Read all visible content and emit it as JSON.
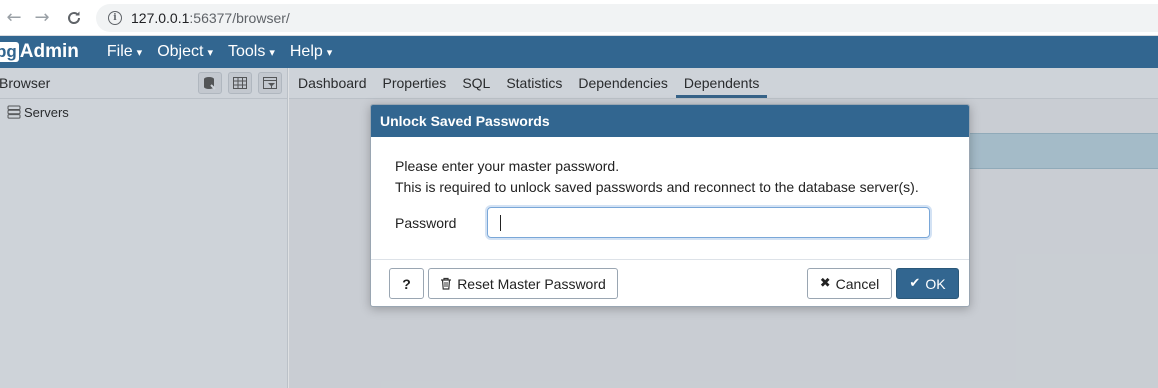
{
  "browser": {
    "url_host": "127.0.0.1",
    "url_rest": ":56377/browser/"
  },
  "navbar": {
    "logo_pg": "pg",
    "logo_admin": "Admin",
    "menus": [
      "File",
      "Object",
      "Tools",
      "Help"
    ]
  },
  "left_panel": {
    "title": "Browser",
    "tree": [
      {
        "label": "Servers"
      }
    ]
  },
  "tabs": [
    "Dashboard",
    "Properties",
    "SQL",
    "Statistics",
    "Dependencies",
    "Dependents"
  ],
  "active_tab": "Dependents",
  "dialog": {
    "title": "Unlock Saved Passwords",
    "message_line1": "Please enter your master password.",
    "message_line2": "This is required to unlock saved passwords and reconnect to the database server(s).",
    "password_label": "Password",
    "password_value": "",
    "help_label": "?",
    "reset_label": "Reset Master Password",
    "cancel_label": "Cancel",
    "ok_label": "OK"
  },
  "colors": {
    "brand": "#326690"
  }
}
